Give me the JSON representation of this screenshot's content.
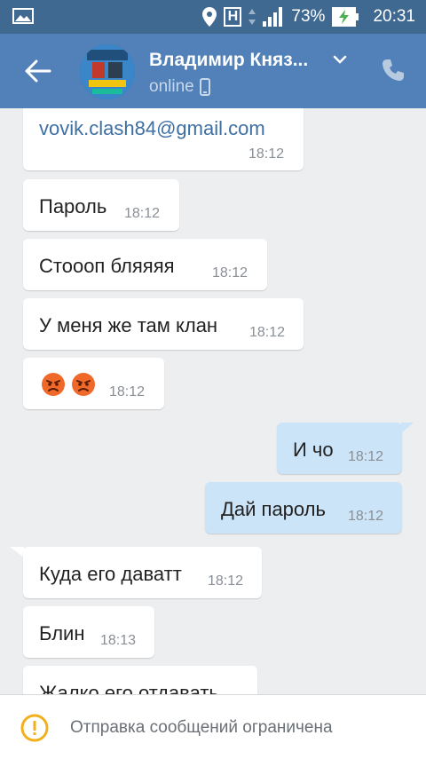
{
  "status_bar": {
    "battery_percent": "73%",
    "time": "20:31",
    "network_letter": "H"
  },
  "header": {
    "name": "Владимир Княз...",
    "status": "online"
  },
  "messages": [
    {
      "text": "vovik.clash84@gmail.com",
      "time": "18:12",
      "direction": "in"
    },
    {
      "text": "Пароль",
      "time": "18:12",
      "direction": "in"
    },
    {
      "text": "Стоооп бляяяя",
      "time": "18:12",
      "direction": "in"
    },
    {
      "text": "У меня же там клан",
      "time": "18:12",
      "direction": "in"
    },
    {
      "text": "😡😡",
      "time": "18:12",
      "direction": "in"
    },
    {
      "text": "И чо",
      "time": "18:12",
      "direction": "out"
    },
    {
      "text": "Дай пароль",
      "time": "18:12",
      "direction": "out"
    },
    {
      "text": "Куда его даватт",
      "time": "18:12",
      "direction": "in"
    },
    {
      "text": "Блин",
      "time": "18:13",
      "direction": "in"
    },
    {
      "text": "Жалко его отдавать",
      "time": "",
      "direction": "in"
    }
  ],
  "footer": {
    "notice": "Отправка сообщений ограничена"
  },
  "colors": {
    "header": "#5181b8",
    "status_bar": "#3f6991",
    "incoming_bubble": "#ffffff",
    "outgoing_bubble": "#cce4f7",
    "chat_background": "#edeef0",
    "warning": "#f2b01e"
  },
  "icons": [
    "image-icon",
    "location-icon",
    "h-network-icon",
    "signal-icon",
    "battery-charging-icon",
    "back-arrow-icon",
    "avatar",
    "chevron-down-icon",
    "phone-icon",
    "mobile-icon",
    "warning-icon",
    "angry-emoji-icon"
  ]
}
